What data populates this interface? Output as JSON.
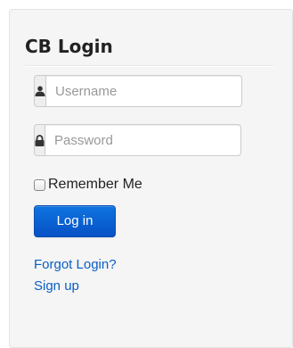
{
  "login_module": {
    "title": "CB Login",
    "username": {
      "value": "",
      "placeholder": "Username",
      "icon": "user-icon"
    },
    "password": {
      "value": "",
      "placeholder": "Password",
      "icon": "lock-icon"
    },
    "remember_label": "Remember Me",
    "remember_checked": false,
    "login_button_label": "Log in",
    "forgot_link": "Forgot Login?",
    "signup_link": "Sign up"
  },
  "colors": {
    "panel_background": "#f5f5f5",
    "button_primary": "#0b62d6",
    "link": "#0a5ec4",
    "title_text": "#222222"
  }
}
